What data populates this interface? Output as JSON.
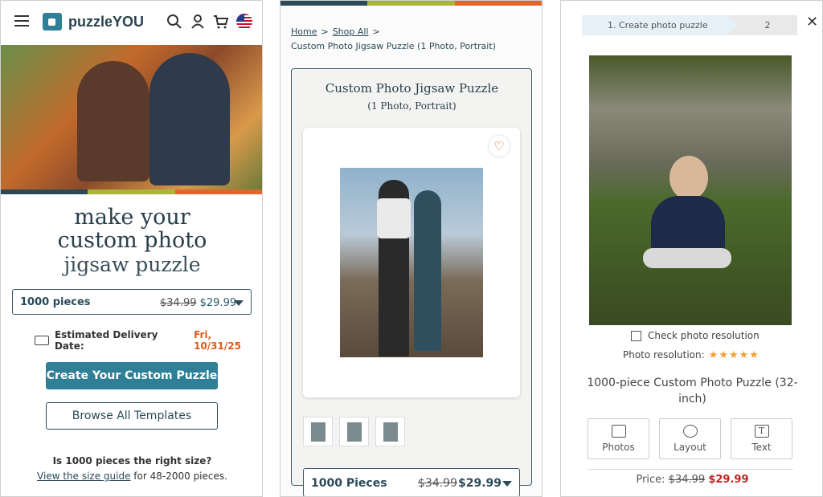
{
  "panel1": {
    "brand": "puzzleYOU",
    "headline_line1": "make your",
    "headline_line2": "custom photo",
    "headline_line3": "jigsaw puzzle",
    "select": {
      "label": "1000 pieces",
      "old_price": "$34.99",
      "new_price": "$29.99"
    },
    "delivery": {
      "prefix": "Estimated Delivery Date:",
      "date": "Fri, 10/31/25"
    },
    "primary_button": "Create Your Custom Puzzle",
    "secondary_button": "Browse All Templates",
    "size_question": "Is 1000 pieces the right size?",
    "size_link": "View the size guide",
    "size_suffix": " for 48-2000 pieces."
  },
  "panel2": {
    "breadcrumb": {
      "home": "Home",
      "shop": "Shop All",
      "current": "Custom Photo Jigsaw Puzzle (1 Photo, Portrait)"
    },
    "title": "Custom Photo Jigsaw Puzzle",
    "subtitle": "(1 Photo, Portrait)",
    "select": {
      "label": "1000 Pieces",
      "old_price": "$34.99",
      "new_price": "$29.99"
    }
  },
  "panel3": {
    "step1": "1. Create photo puzzle",
    "step2": "2",
    "check_label": "Check photo resolution",
    "resolution_label": "Photo resolution:",
    "stars": "★★★★★",
    "product_title": "1000-piece Custom Photo Puzzle (32-inch)",
    "tools": [
      "Photos",
      "Layout",
      "Text"
    ],
    "price": {
      "label": "Price:",
      "old": "$34.99",
      "new": "$29.99"
    }
  },
  "colors": {
    "teal": "#2f7f96",
    "navy": "#2a4a58",
    "orange": "#e0672a",
    "green": "#a9b43a",
    "red": "#c0201f"
  },
  "icons": [
    "menu-icon",
    "search-icon",
    "user-icon",
    "cart-icon",
    "us-flag-icon",
    "truck-icon",
    "heart-icon",
    "chevron-down-icon",
    "close-icon",
    "photo-icon",
    "eye-icon",
    "text-icon"
  ]
}
